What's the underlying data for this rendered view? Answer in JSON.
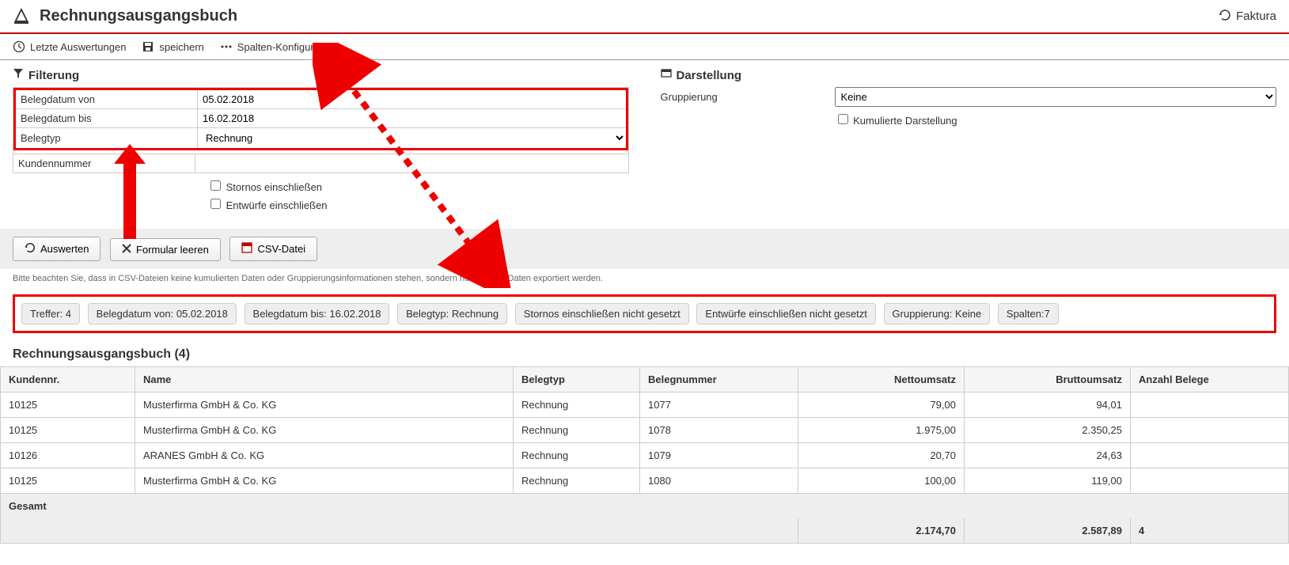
{
  "header": {
    "title": "Rechnungsausgangsbuch",
    "faktura": "Faktura"
  },
  "toolbar": {
    "last_eval": "Letzte Auswertungen",
    "save": "speichern",
    "columns": "Spalten-Konfiguration"
  },
  "filter": {
    "section": "Filterung",
    "labels": {
      "von": "Belegdatum von",
      "bis": "Belegdatum bis",
      "typ": "Belegtyp",
      "kunde": "Kundennummer"
    },
    "values": {
      "von": "05.02.2018",
      "bis": "16.02.2018",
      "typ": "Rechnung",
      "kunde": ""
    },
    "checkboxes": {
      "storno": "Stornos einschließen",
      "entwurf": "Entwürfe einschließen"
    }
  },
  "darstellung": {
    "section": "Darstellung",
    "group_label": "Gruppierung",
    "group_value": "Keine",
    "kumuliert": "Kumulierte Darstellung"
  },
  "actions": {
    "auswerten": "Auswerten",
    "leeren": "Formular leeren",
    "csv": "CSV-Datei"
  },
  "hint": "Bitte beachten Sie, dass in CSV-Dateien keine kumulierten Daten oder Gruppierungsinformationen stehen, sondern nur die Roh-Daten exportiert werden.",
  "tags": [
    "Treffer: 4",
    "Belegdatum von: 05.02.2018",
    "Belegdatum bis: 16.02.2018",
    "Belegtyp: Rechnung",
    "Stornos einschließen nicht gesetzt",
    "Entwürfe einschließen nicht gesetzt",
    "Gruppierung: Keine",
    "Spalten:7"
  ],
  "results": {
    "title": "Rechnungsausgangsbuch (4)",
    "columns": [
      "Kundennr.",
      "Name",
      "Belegtyp",
      "Belegnummer",
      "Nettoumsatz",
      "Bruttoumsatz",
      "Anzahl Belege"
    ],
    "rows": [
      {
        "kundennr": "10125",
        "name": "Musterfirma GmbH & Co. KG",
        "typ": "Rechnung",
        "nr": "1077",
        "netto": "79,00",
        "brutto": "94,01",
        "anzahl": ""
      },
      {
        "kundennr": "10125",
        "name": "Musterfirma GmbH & Co. KG",
        "typ": "Rechnung",
        "nr": "1078",
        "netto": "1.975,00",
        "brutto": "2.350,25",
        "anzahl": ""
      },
      {
        "kundennr": "10126",
        "name": "ARANES GmbH & Co. KG",
        "typ": "Rechnung",
        "nr": "1079",
        "netto": "20,70",
        "brutto": "24,63",
        "anzahl": ""
      },
      {
        "kundennr": "10125",
        "name": "Musterfirma GmbH & Co. KG",
        "typ": "Rechnung",
        "nr": "1080",
        "netto": "100,00",
        "brutto": "119,00",
        "anzahl": ""
      }
    ],
    "total_label": "Gesamt",
    "totals": {
      "netto": "2.174,70",
      "brutto": "2.587,89",
      "anzahl": "4"
    }
  }
}
